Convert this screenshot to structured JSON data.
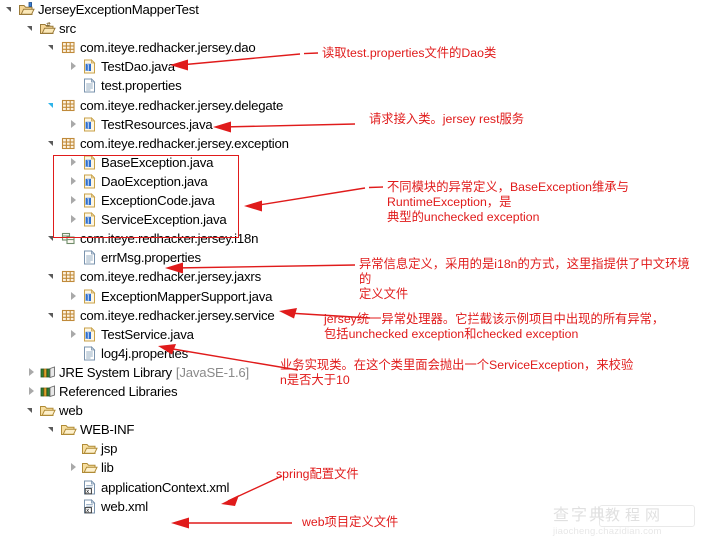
{
  "tree": {
    "rows": [
      {
        "indent": 0,
        "twisty": "open",
        "icon": "project-icon",
        "label": "JerseyExceptionMapperTest",
        "sublabel": ""
      },
      {
        "indent": 1,
        "twisty": "open",
        "icon": "source-folder-icon",
        "label": "src",
        "sublabel": ""
      },
      {
        "indent": 2,
        "twisty": "open",
        "icon": "package-icon",
        "label": "com.iteye.redhacker.jersey.dao",
        "sublabel": ""
      },
      {
        "indent": 3,
        "twisty": "closed",
        "icon": "java-file-icon",
        "label": "TestDao.java",
        "sublabel": ""
      },
      {
        "indent": 3,
        "twisty": "none",
        "icon": "properties-file-icon",
        "label": "test.properties",
        "sublabel": ""
      },
      {
        "indent": 2,
        "twisty": "open-selected",
        "icon": "package-icon",
        "label": "com.iteye.redhacker.jersey.delegate",
        "sublabel": ""
      },
      {
        "indent": 3,
        "twisty": "closed",
        "icon": "java-file-icon",
        "label": "TestResources.java",
        "sublabel": ""
      },
      {
        "indent": 2,
        "twisty": "open",
        "icon": "package-icon",
        "label": "com.iteye.redhacker.jersey.exception",
        "sublabel": ""
      },
      {
        "indent": 3,
        "twisty": "closed",
        "icon": "java-file-icon",
        "label": "BaseException.java",
        "sublabel": ""
      },
      {
        "indent": 3,
        "twisty": "closed",
        "icon": "java-file-icon",
        "label": "DaoException.java",
        "sublabel": ""
      },
      {
        "indent": 3,
        "twisty": "closed",
        "icon": "java-file-icon",
        "label": "ExceptionCode.java",
        "sublabel": ""
      },
      {
        "indent": 3,
        "twisty": "closed",
        "icon": "java-file-icon",
        "label": "ServiceException.java",
        "sublabel": ""
      },
      {
        "indent": 2,
        "twisty": "open",
        "icon": "package-empty-icon",
        "label": "com.iteye.redhacker.jersey.i18n",
        "sublabel": ""
      },
      {
        "indent": 3,
        "twisty": "none",
        "icon": "properties-file-icon",
        "label": "errMsg.properties",
        "sublabel": ""
      },
      {
        "indent": 2,
        "twisty": "open",
        "icon": "package-icon",
        "label": "com.iteye.redhacker.jersey.jaxrs",
        "sublabel": ""
      },
      {
        "indent": 3,
        "twisty": "closed",
        "icon": "java-file-icon",
        "label": "ExceptionMapperSupport.java",
        "sublabel": ""
      },
      {
        "indent": 2,
        "twisty": "open",
        "icon": "package-icon",
        "label": "com.iteye.redhacker.jersey.service",
        "sublabel": ""
      },
      {
        "indent": 3,
        "twisty": "closed",
        "icon": "java-file-icon",
        "label": "TestService.java",
        "sublabel": ""
      },
      {
        "indent": 3,
        "twisty": "none",
        "icon": "properties-file-icon",
        "label": "log4j.properties",
        "sublabel": ""
      },
      {
        "indent": 1,
        "twisty": "closed",
        "icon": "library-icon",
        "label": "JRE System Library",
        "sublabel": "[JavaSE-1.6]"
      },
      {
        "indent": 1,
        "twisty": "closed",
        "icon": "library-icon",
        "label": "Referenced Libraries",
        "sublabel": ""
      },
      {
        "indent": 1,
        "twisty": "open",
        "icon": "folder-icon",
        "label": "web",
        "sublabel": ""
      },
      {
        "indent": 2,
        "twisty": "open",
        "icon": "folder-icon",
        "label": "WEB-INF",
        "sublabel": ""
      },
      {
        "indent": 3,
        "twisty": "none",
        "icon": "folder-icon",
        "label": "jsp",
        "sublabel": ""
      },
      {
        "indent": 3,
        "twisty": "closed",
        "icon": "folder-icon",
        "label": "lib",
        "sublabel": ""
      },
      {
        "indent": 3,
        "twisty": "none",
        "icon": "xml-file-icon",
        "label": "applicationContext.xml",
        "sublabel": ""
      },
      {
        "indent": 3,
        "twisty": "none",
        "icon": "xml-file-icon",
        "label": "web.xml",
        "sublabel": ""
      }
    ]
  },
  "highlight_box": {
    "name": "exception-classes-highlight"
  },
  "annotations": [
    {
      "id": "anno-dao",
      "text": "读取test.properties文件的Dao类"
    },
    {
      "id": "anno-resources",
      "text": "请求接入类。jersey rest服务"
    },
    {
      "id": "anno-exception",
      "text": "不同模块的异常定义，BaseException维承与RuntimeException，是\n典型的unchecked exception"
    },
    {
      "id": "anno-i18n",
      "text": "异常信息定义，采用的是i18n的方式，这里指提供了中文环境的\n定义文件"
    },
    {
      "id": "anno-jaxrs",
      "text": "jersey统一异常处理器。它拦截该示例项目中出现的所有异常，\n包括unchecked exception和checked exception"
    },
    {
      "id": "anno-service",
      "text": "业务实现类。在这个类里面会抛出一个ServiceException，来校验\nn是否大于10"
    },
    {
      "id": "anno-spring",
      "text": "spring配置文件"
    },
    {
      "id": "anno-webxml",
      "text": "web项目定义文件"
    }
  ],
  "watermark": {
    "cn1": "查字典",
    "cn2": "教程网",
    "url": "jiaocheng.chazidian.com"
  },
  "colors": {
    "annotation_red": "#e01b1b",
    "tree_text": "#000000",
    "sublabel_gray": "#8a8a8a",
    "highlight_border": "#e01b1b"
  }
}
